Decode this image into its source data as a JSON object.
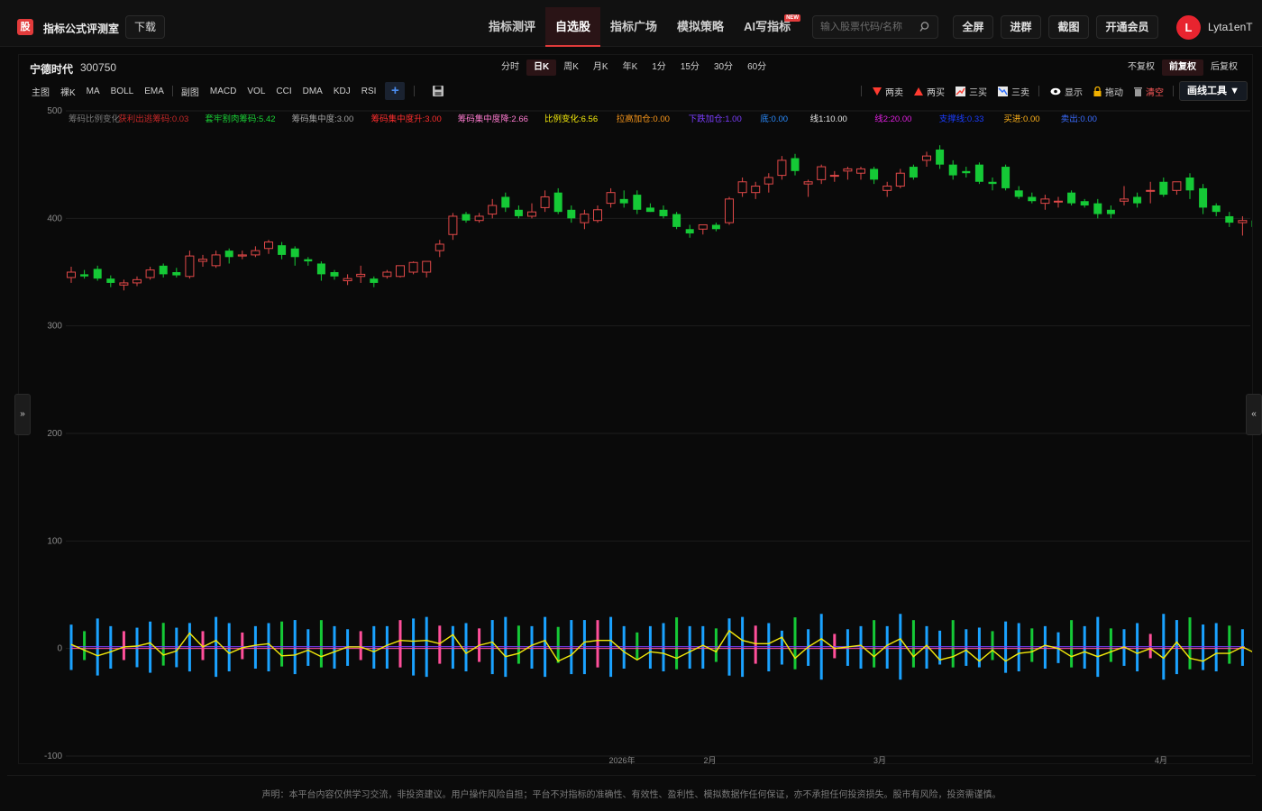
{
  "header": {
    "logo_char": "股",
    "brand": "指标公式评测室",
    "download_label": "下载",
    "nav": [
      {
        "label": "指标测评",
        "active": false
      },
      {
        "label": "自选股",
        "active": true
      },
      {
        "label": "指标广场",
        "active": false
      },
      {
        "label": "模拟策略",
        "active": false
      },
      {
        "label": "AI写指标",
        "active": false,
        "badge": "NEW"
      }
    ],
    "search_placeholder": "输入股票代码/名称",
    "buttons": {
      "fullscreen": "全屏",
      "join_group": "进群",
      "screenshot": "截图",
      "membership": "开通会员"
    },
    "avatar_letter": "L",
    "username": "Lyta1enT"
  },
  "stock": {
    "name": "宁德时代",
    "code": "300750"
  },
  "periods": [
    "分时",
    "日K",
    "周K",
    "月K",
    "年K",
    "1分",
    "15分",
    "30分",
    "60分"
  ],
  "active_period": "日K",
  "adjust": [
    "不复权",
    "前复权",
    "后复权"
  ],
  "active_adjust": "前复权",
  "indicators": {
    "main_label": "主图",
    "main": [
      "裸K",
      "MA",
      "BOLL",
      "EMA"
    ],
    "sub_label": "副图",
    "sub": [
      "MACD",
      "VOL",
      "CCI",
      "DMA",
      "KDJ",
      "RSI"
    ],
    "add_label": "+"
  },
  "tools": {
    "two_sell": "两卖",
    "two_buy": "两买",
    "three_buy": "三买",
    "three_sell": "三卖",
    "show": "显示",
    "drag": "拖动",
    "clear": "清空",
    "draw_tools": "画线工具 ▼"
  },
  "side": {
    "left": "»",
    "right": "«"
  },
  "footer": "声明：本平台内容仅供学习交流，非投资建议。用户操作风险自担；平台不对指标的准确性、有效性、盈利性、模拟数据作任何保证，亦不承担任何投资损失。股市有风险，投资需谨慎。",
  "colors": {
    "up": "#e04848",
    "down": "#15c936",
    "accent": "#e03a3a",
    "bar_blue": "#1aa2ff",
    "bar_pink": "#ff4f9a",
    "line_yellow": "#f3e90b"
  },
  "chart_data": {
    "type": "candlestick",
    "ylim": [
      -100,
      500
    ],
    "y_ticks": [
      500,
      400,
      300,
      200,
      100,
      0,
      -100
    ],
    "x_tick_labels": [
      "2026年",
      "2月",
      "3月",
      "4月"
    ],
    "indicator_legend": [
      {
        "text": "筹码比例变化",
        "color": "#7a7a7a"
      },
      {
        "text": "获利出逃筹码:0.03",
        "color": "#c62828"
      },
      {
        "text": "套牢割肉筹码:5.42",
        "color": "#19d135"
      },
      {
        "text": "筹码集中度:3.00",
        "color": "#a0a0a0"
      },
      {
        "text": "筹码集中度升:3.00",
        "color": "#ff2d2d"
      },
      {
        "text": "筹码集中度降:2.66",
        "color": "#ff7bd0"
      },
      {
        "text": "比例变化:6.56",
        "color": "#f3e90b"
      },
      {
        "text": "拉高加仓:0.00",
        "color": "#ff9a1a"
      },
      {
        "text": "下跌加仓:1.00",
        "color": "#7b3dff"
      },
      {
        "text": "底:0.00",
        "color": "#2a8cff"
      },
      {
        "text": "线1:10.00",
        "color": "#e6e6e6"
      },
      {
        "text": "线2:20.00",
        "color": "#e01fe0"
      },
      {
        "text": "支撑线:0.33",
        "color": "#1a3cff"
      },
      {
        "text": "买进:0.00",
        "color": "#ffb21a"
      },
      {
        "text": "卖出:0.00",
        "color": "#3a6cff"
      }
    ],
    "ohlc": [
      [
        345,
        355,
        340,
        350
      ],
      [
        348,
        352,
        344,
        346
      ],
      [
        353,
        356,
        342,
        344
      ],
      [
        344,
        347,
        336,
        340
      ],
      [
        338,
        343,
        333,
        340
      ],
      [
        340,
        346,
        337,
        343
      ],
      [
        345,
        355,
        343,
        352
      ],
      [
        356,
        358,
        345,
        348
      ],
      [
        350,
        354,
        345,
        347
      ],
      [
        346,
        370,
        344,
        365
      ],
      [
        360,
        366,
        355,
        362
      ],
      [
        356,
        370,
        354,
        366
      ],
      [
        370,
        372,
        358,
        364
      ],
      [
        365,
        370,
        362,
        366
      ],
      [
        366,
        374,
        364,
        370
      ],
      [
        372,
        380,
        367,
        378
      ],
      [
        375,
        378,
        362,
        366
      ],
      [
        372,
        374,
        356,
        364
      ],
      [
        362,
        364,
        356,
        360
      ],
      [
        358,
        360,
        342,
        348
      ],
      [
        350,
        352,
        343,
        346
      ],
      [
        342,
        348,
        338,
        344
      ],
      [
        346,
        356,
        340,
        348
      ],
      [
        344,
        346,
        336,
        340
      ],
      [
        346,
        352,
        344,
        350
      ],
      [
        346,
        356,
        345,
        356
      ],
      [
        350,
        360,
        348,
        359
      ],
      [
        350,
        360,
        345,
        360
      ],
      [
        370,
        380,
        364,
        376
      ],
      [
        385,
        405,
        380,
        402
      ],
      [
        404,
        406,
        396,
        398
      ],
      [
        398,
        405,
        396,
        402
      ],
      [
        404,
        418,
        400,
        412
      ],
      [
        420,
        424,
        406,
        410
      ],
      [
        408,
        412,
        400,
        402
      ],
      [
        402,
        414,
        400,
        406
      ],
      [
        410,
        426,
        406,
        420
      ],
      [
        424,
        428,
        404,
        406
      ],
      [
        408,
        412,
        396,
        400
      ],
      [
        396,
        408,
        390,
        404
      ],
      [
        398,
        412,
        396,
        408
      ],
      [
        414,
        428,
        410,
        424
      ],
      [
        418,
        426,
        410,
        414
      ],
      [
        422,
        426,
        404,
        408
      ],
      [
        410,
        414,
        406,
        406
      ],
      [
        408,
        412,
        400,
        402
      ],
      [
        404,
        406,
        390,
        392
      ],
      [
        390,
        394,
        382,
        386
      ],
      [
        390,
        394,
        385,
        394
      ],
      [
        394,
        396,
        388,
        390
      ],
      [
        396,
        420,
        394,
        418
      ],
      [
        424,
        438,
        420,
        434
      ],
      [
        424,
        434,
        418,
        430
      ],
      [
        432,
        442,
        424,
        438
      ],
      [
        440,
        458,
        436,
        454
      ],
      [
        456,
        460,
        440,
        444
      ],
      [
        432,
        436,
        420,
        434
      ],
      [
        436,
        450,
        432,
        448
      ],
      [
        440,
        444,
        434,
        440
      ],
      [
        444,
        448,
        436,
        446
      ],
      [
        442,
        448,
        436,
        446
      ],
      [
        446,
        448,
        432,
        436
      ],
      [
        426,
        434,
        420,
        430
      ],
      [
        430,
        446,
        428,
        442
      ],
      [
        448,
        450,
        436,
        438
      ],
      [
        454,
        462,
        448,
        458
      ],
      [
        464,
        468,
        446,
        450
      ],
      [
        450,
        454,
        436,
        440
      ],
      [
        444,
        448,
        438,
        442
      ],
      [
        450,
        452,
        432,
        434
      ],
      [
        434,
        438,
        426,
        432
      ],
      [
        448,
        450,
        426,
        428
      ],
      [
        426,
        430,
        418,
        420
      ],
      [
        420,
        424,
        414,
        416
      ],
      [
        414,
        422,
        408,
        418
      ],
      [
        416,
        420,
        410,
        416
      ],
      [
        424,
        426,
        412,
        414
      ],
      [
        416,
        418,
        410,
        412
      ],
      [
        414,
        418,
        400,
        404
      ],
      [
        408,
        412,
        400,
        404
      ],
      [
        416,
        430,
        412,
        418
      ],
      [
        420,
        424,
        410,
        414
      ],
      [
        426,
        434,
        414,
        426
      ],
      [
        434,
        438,
        420,
        422
      ],
      [
        426,
        434,
        422,
        434
      ],
      [
        438,
        442,
        418,
        426
      ],
      [
        428,
        432,
        404,
        410
      ],
      [
        412,
        414,
        402,
        406
      ],
      [
        402,
        406,
        392,
        396
      ],
      [
        396,
        402,
        384,
        398
      ],
      [
        398,
        400,
        386,
        392
      ]
    ]
  }
}
